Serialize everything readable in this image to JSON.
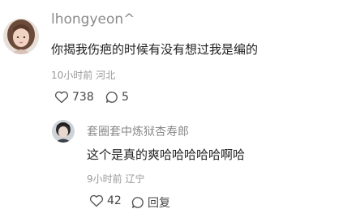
{
  "comment": {
    "username": "lhongyeon^",
    "avatar_icon": "user-avatar-photo",
    "text": "你揭我伤疤的时候有没有想过我是编的",
    "time": "10小时前",
    "location": "河北",
    "likes": "738",
    "replies": "5",
    "like_icon": "heart-outline-icon",
    "reply_icon": "speech-bubble-icon"
  },
  "reply": {
    "username": "套圈套中炼狱杏寿郎",
    "avatar_icon": "user-avatar-photo",
    "text": "这个是真的爽哈哈哈哈哈啊哈",
    "time": "9小时前",
    "location": "辽宁",
    "likes": "42",
    "reply_label": "回复",
    "like_icon": "heart-outline-icon",
    "reply_icon": "speech-bubble-icon"
  }
}
